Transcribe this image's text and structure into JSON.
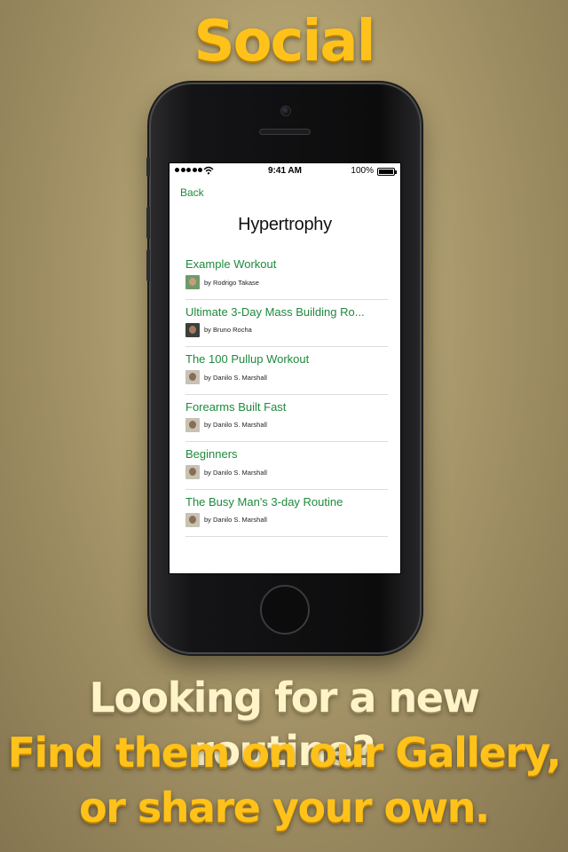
{
  "promo": {
    "title": "Social",
    "tagline": [
      "Looking for a new routine?",
      "Find them on our Gallery,",
      "or share your own."
    ]
  },
  "status_bar": {
    "time": "9:41 AM",
    "battery": "100%",
    "battery_level": 1.0
  },
  "nav": {
    "back_label": "Back"
  },
  "page": {
    "title": "Hypertrophy"
  },
  "routines": [
    {
      "title": "Example Workout",
      "author": "by Rodrigo Takase",
      "avatar_bg": "#6f9a6a",
      "avatar_face": "#c79c7c"
    },
    {
      "title": "Ultimate 3-Day Mass Building Ro...",
      "author": "by Bruno Rocha",
      "avatar_bg": "#3b3f3d",
      "avatar_face": "#a57b5f"
    },
    {
      "title": "The 100 Pullup Workout",
      "author": "by Danilo S. Marshall",
      "avatar_bg": "#c8c2b4",
      "avatar_face": "#8a6d55"
    },
    {
      "title": "Forearms Built Fast",
      "author": "by Danilo S. Marshall",
      "avatar_bg": "#c8c2b4",
      "avatar_face": "#8a6d55"
    },
    {
      "title": "Beginners",
      "author": "by Danilo S. Marshall",
      "avatar_bg": "#c8c2b4",
      "avatar_face": "#8a6d55"
    },
    {
      "title": "The Busy Man's 3-day Routine",
      "author": "by Danilo S. Marshall",
      "avatar_bg": "#c8c2b4",
      "avatar_face": "#8a6d55"
    }
  ],
  "colors": {
    "accent": "#1e8a3c",
    "headline": "#ffc21a"
  }
}
